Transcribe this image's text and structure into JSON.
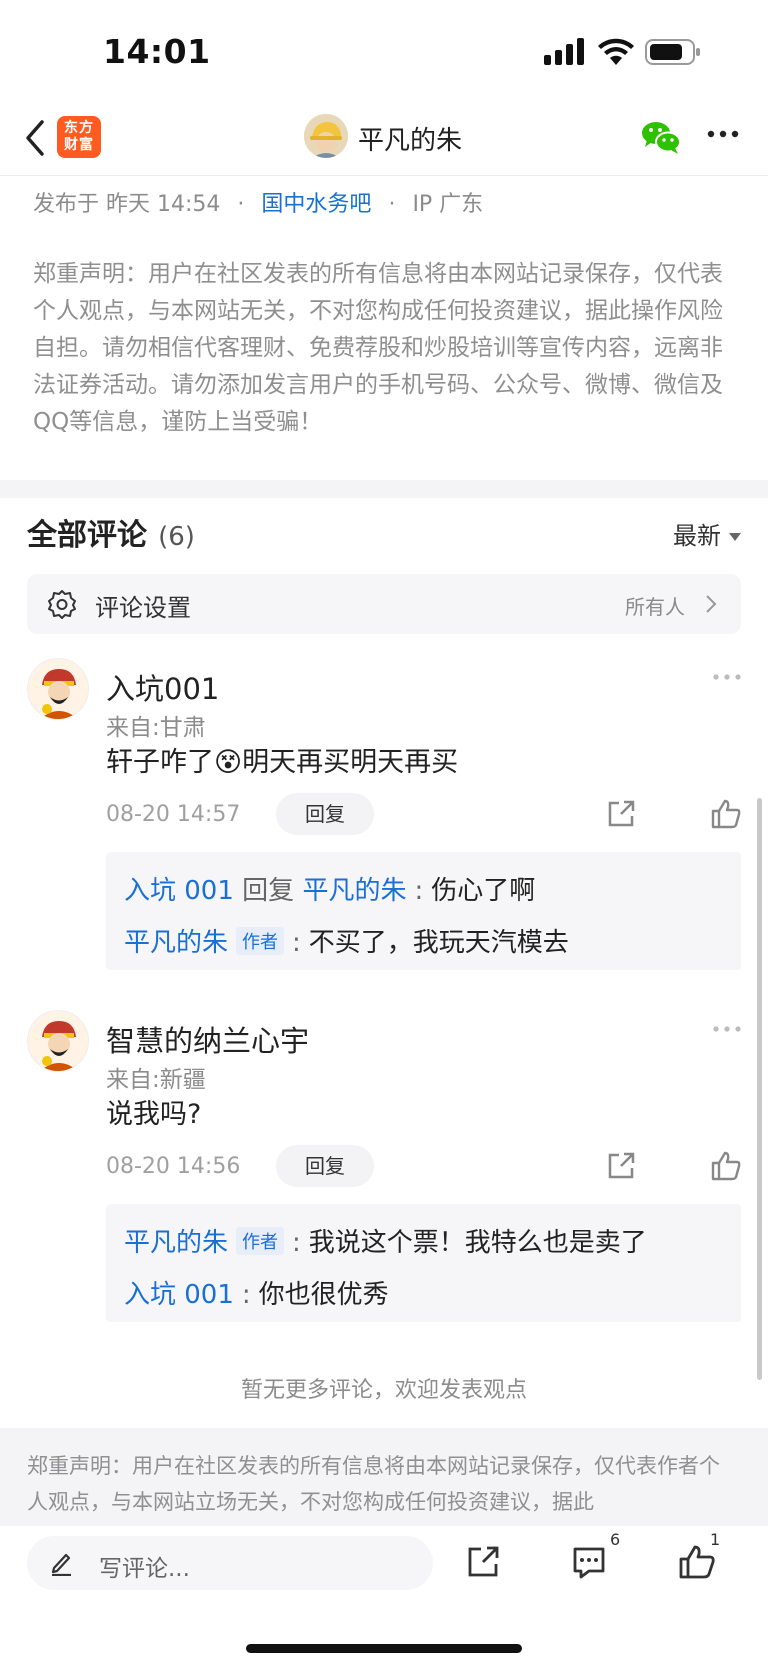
{
  "status_bar": {
    "time": "14:01"
  },
  "nav": {
    "logo_text": "东方财富",
    "logo_line1": "东方",
    "logo_line2": "财富",
    "title": "平凡的朱"
  },
  "post_meta": {
    "published_prefix": "发布于",
    "published_time": "昨天 14:54",
    "bar_name": "国中水务吧",
    "ip": "IP 广东"
  },
  "disclaimer_top": "郑重声明：用户在社区发表的所有信息将由本网站记录保存，仅代表个人观点，与本网站无关，不对您构成任何投资建议，据此操作风险自担。请勿相信代客理财、免费荐股和炒股培训等宣传内容，远离非法证券活动。请勿添加发言用户的手机号码、公众号、微博、微信及QQ等信息，谨防上当受骗！",
  "comments_section": {
    "title": "全部评论",
    "count": "(6)",
    "sort_label": "最新",
    "settings_label": "评论设置",
    "settings_value": "所有人"
  },
  "comments": [
    {
      "user": "入坑001",
      "from": "来自:甘肃",
      "text_before": "轩子咋了",
      "emoji": "😵",
      "text_after": "明天再买明天再买",
      "date": "08-20 14:57",
      "reply_label": "回复",
      "replies": [
        {
          "user": "入坑 001",
          "reply_word": "回复",
          "target": "平凡的朱",
          "text": "伤心了啊"
        },
        {
          "user": "平凡的朱",
          "tag": "作者",
          "text": "不买了，我玩天汽模去"
        }
      ]
    },
    {
      "user": "智慧的纳兰心宇",
      "from": "来自:新疆",
      "text": "说我吗?",
      "date": "08-20 14:56",
      "reply_label": "回复",
      "replies": [
        {
          "user": "平凡的朱",
          "tag": "作者",
          "text": "我说这个票！我特么也是卖了"
        },
        {
          "user": "入坑 001",
          "text": "你也很优秀"
        }
      ]
    }
  ],
  "no_more_text": "暂无更多评论，欢迎发表观点",
  "disclaimer_bottom": "郑重声明：用户在社区发表的所有信息将由本网站记录保存，仅代表作者个人观点，与本网站立场无关，不对您构成任何投资建议，据此",
  "bottom_bar": {
    "write_placeholder": "写评论...",
    "comment_count": "6",
    "like_count": "1"
  },
  "colors": {
    "link_blue": "#1a6fd6",
    "brand_orange": "#ff5a1f",
    "wechat_green": "#2dc100"
  },
  "icons": [
    "back-icon",
    "wechat-icon",
    "more-icon",
    "gear-icon",
    "chevron-right-icon",
    "share-icon",
    "like-icon",
    "pen-icon",
    "comment-icon"
  ]
}
